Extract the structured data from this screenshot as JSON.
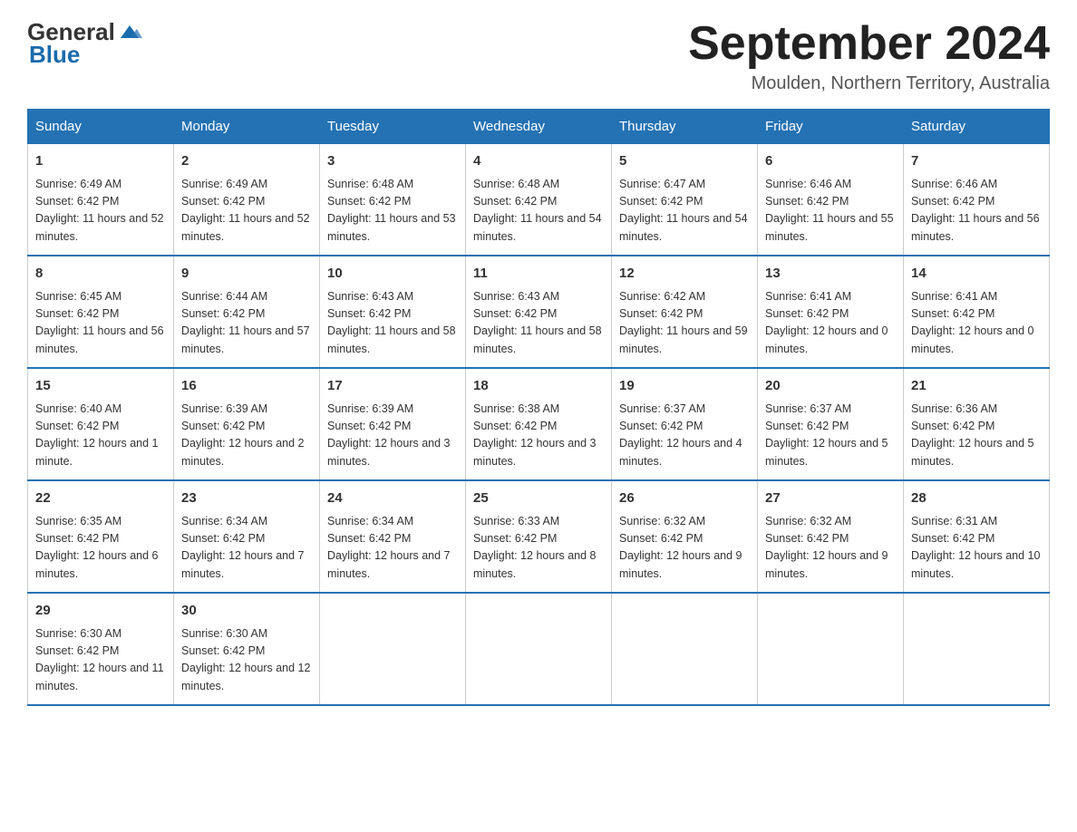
{
  "header": {
    "logo": {
      "text_general": "General",
      "text_blue": "Blue",
      "icon_alt": "GeneralBlue logo"
    },
    "title": "September 2024",
    "subtitle": "Moulden, Northern Territory, Australia"
  },
  "calendar": {
    "weekdays": [
      "Sunday",
      "Monday",
      "Tuesday",
      "Wednesday",
      "Thursday",
      "Friday",
      "Saturday"
    ],
    "weeks": [
      [
        {
          "day": "1",
          "sunrise": "6:49 AM",
          "sunset": "6:42 PM",
          "daylight": "11 hours and 52 minutes."
        },
        {
          "day": "2",
          "sunrise": "6:49 AM",
          "sunset": "6:42 PM",
          "daylight": "11 hours and 52 minutes."
        },
        {
          "day": "3",
          "sunrise": "6:48 AM",
          "sunset": "6:42 PM",
          "daylight": "11 hours and 53 minutes."
        },
        {
          "day": "4",
          "sunrise": "6:48 AM",
          "sunset": "6:42 PM",
          "daylight": "11 hours and 54 minutes."
        },
        {
          "day": "5",
          "sunrise": "6:47 AM",
          "sunset": "6:42 PM",
          "daylight": "11 hours and 54 minutes."
        },
        {
          "day": "6",
          "sunrise": "6:46 AM",
          "sunset": "6:42 PM",
          "daylight": "11 hours and 55 minutes."
        },
        {
          "day": "7",
          "sunrise": "6:46 AM",
          "sunset": "6:42 PM",
          "daylight": "11 hours and 56 minutes."
        }
      ],
      [
        {
          "day": "8",
          "sunrise": "6:45 AM",
          "sunset": "6:42 PM",
          "daylight": "11 hours and 56 minutes."
        },
        {
          "day": "9",
          "sunrise": "6:44 AM",
          "sunset": "6:42 PM",
          "daylight": "11 hours and 57 minutes."
        },
        {
          "day": "10",
          "sunrise": "6:43 AM",
          "sunset": "6:42 PM",
          "daylight": "11 hours and 58 minutes."
        },
        {
          "day": "11",
          "sunrise": "6:43 AM",
          "sunset": "6:42 PM",
          "daylight": "11 hours and 58 minutes."
        },
        {
          "day": "12",
          "sunrise": "6:42 AM",
          "sunset": "6:42 PM",
          "daylight": "11 hours and 59 minutes."
        },
        {
          "day": "13",
          "sunrise": "6:41 AM",
          "sunset": "6:42 PM",
          "daylight": "12 hours and 0 minutes."
        },
        {
          "day": "14",
          "sunrise": "6:41 AM",
          "sunset": "6:42 PM",
          "daylight": "12 hours and 0 minutes."
        }
      ],
      [
        {
          "day": "15",
          "sunrise": "6:40 AM",
          "sunset": "6:42 PM",
          "daylight": "12 hours and 1 minute."
        },
        {
          "day": "16",
          "sunrise": "6:39 AM",
          "sunset": "6:42 PM",
          "daylight": "12 hours and 2 minutes."
        },
        {
          "day": "17",
          "sunrise": "6:39 AM",
          "sunset": "6:42 PM",
          "daylight": "12 hours and 3 minutes."
        },
        {
          "day": "18",
          "sunrise": "6:38 AM",
          "sunset": "6:42 PM",
          "daylight": "12 hours and 3 minutes."
        },
        {
          "day": "19",
          "sunrise": "6:37 AM",
          "sunset": "6:42 PM",
          "daylight": "12 hours and 4 minutes."
        },
        {
          "day": "20",
          "sunrise": "6:37 AM",
          "sunset": "6:42 PM",
          "daylight": "12 hours and 5 minutes."
        },
        {
          "day": "21",
          "sunrise": "6:36 AM",
          "sunset": "6:42 PM",
          "daylight": "12 hours and 5 minutes."
        }
      ],
      [
        {
          "day": "22",
          "sunrise": "6:35 AM",
          "sunset": "6:42 PM",
          "daylight": "12 hours and 6 minutes."
        },
        {
          "day": "23",
          "sunrise": "6:34 AM",
          "sunset": "6:42 PM",
          "daylight": "12 hours and 7 minutes."
        },
        {
          "day": "24",
          "sunrise": "6:34 AM",
          "sunset": "6:42 PM",
          "daylight": "12 hours and 7 minutes."
        },
        {
          "day": "25",
          "sunrise": "6:33 AM",
          "sunset": "6:42 PM",
          "daylight": "12 hours and 8 minutes."
        },
        {
          "day": "26",
          "sunrise": "6:32 AM",
          "sunset": "6:42 PM",
          "daylight": "12 hours and 9 minutes."
        },
        {
          "day": "27",
          "sunrise": "6:32 AM",
          "sunset": "6:42 PM",
          "daylight": "12 hours and 9 minutes."
        },
        {
          "day": "28",
          "sunrise": "6:31 AM",
          "sunset": "6:42 PM",
          "daylight": "12 hours and 10 minutes."
        }
      ],
      [
        {
          "day": "29",
          "sunrise": "6:30 AM",
          "sunset": "6:42 PM",
          "daylight": "12 hours and 11 minutes."
        },
        {
          "day": "30",
          "sunrise": "6:30 AM",
          "sunset": "6:42 PM",
          "daylight": "12 hours and 12 minutes."
        },
        null,
        null,
        null,
        null,
        null
      ]
    ]
  }
}
